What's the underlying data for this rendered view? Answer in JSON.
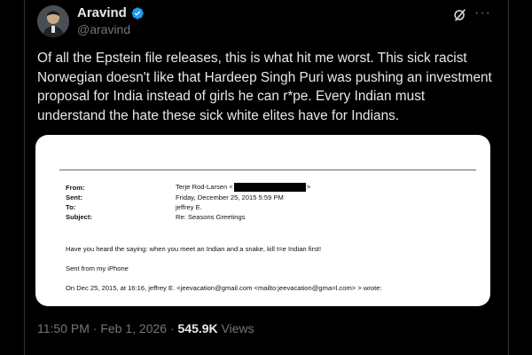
{
  "author": {
    "display_name": "Aravind",
    "handle": "@aravind",
    "avatar_icon": "avatar-portrait",
    "verified_color": "#1d9bf0"
  },
  "tweet": {
    "text": "Of all the Epstein file releases, this is what hit me worst. This sick racist Norwegian doesn't like that Hardeep Singh Puri was pushing an investment proposal for India instead of girls he can r*pe. Every Indian must understand the hate these sick white elites have for Indians."
  },
  "email": {
    "from_label": "From:",
    "from_value_prefix": "Terje Rod-Larsen <",
    "from_value_suffix": ">",
    "sent_label": "Sent:",
    "sent_value": "Friday, December 25, 2015 5:59 PM",
    "to_label": "To:",
    "to_value": "jeffrey E.",
    "subject_label": "Subject:",
    "subject_value": "Re: Seasons Greetings",
    "body_line_1": "Have you heard the saying: when you meet an Indian and a snake, kill t=e Indian first!",
    "body_line_2": "Sent from my iPhone",
    "body_line_3": "On Dec 25, 2015, at 16:16, jeffrey E. <jeevacation@gmail.com <mailto:jeevacation@gma=l.com> > wrote:"
  },
  "meta": {
    "time_date": "11:50 PM · Feb 1, 2026 · ",
    "views_count": "545.9K",
    "views_label": " Views"
  },
  "icons": {
    "grok": "grok-icon",
    "more": "more-options-icon",
    "verified": "verified-badge-icon"
  }
}
